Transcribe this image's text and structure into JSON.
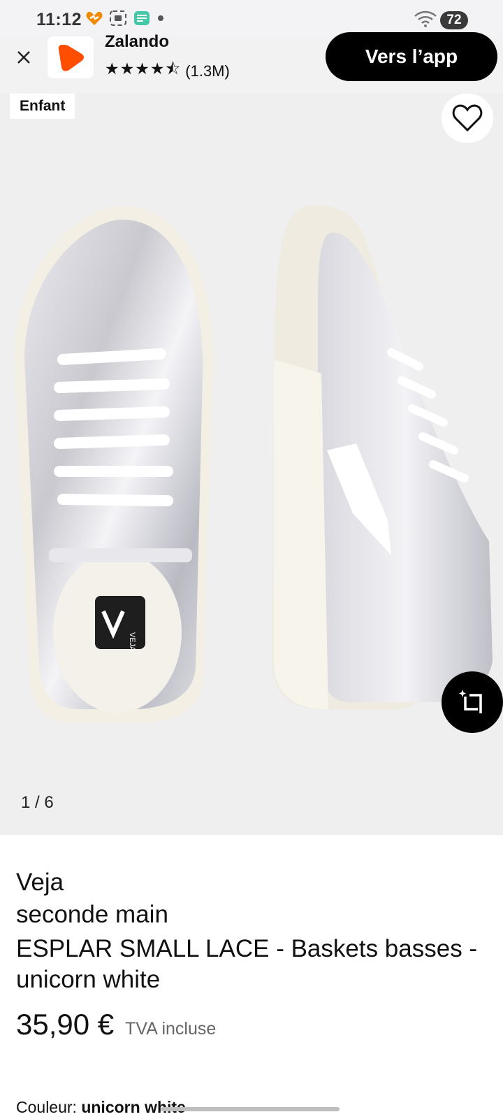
{
  "status_bar": {
    "time": "11:12",
    "battery": "72",
    "wifi_label": "6"
  },
  "banner": {
    "app_name": "Zalando",
    "stars": "★★★★⯪",
    "rating_count": "(1.3M)",
    "open_app_label": "Vers l’app",
    "logo_color": "#ff4e00"
  },
  "gallery": {
    "badge": "Enfant",
    "pager": "1 / 6",
    "insole_brand": "VEJA"
  },
  "product": {
    "brand": "Veja",
    "condition": "seconde main",
    "title": "ESPLAR SMALL LACE - Baskets basses - unicorn white",
    "price": "35,90 €",
    "vat": "TVA incluse",
    "color_label": "Couleur:",
    "color_value": "unicorn white"
  }
}
